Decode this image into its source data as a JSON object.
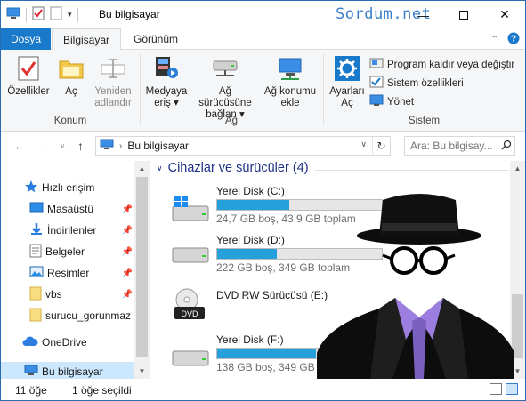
{
  "window": {
    "title": "Bu bilgisayar",
    "watermark": "Sordum.net"
  },
  "tabs": {
    "file": "Dosya",
    "computer": "Bilgisayar",
    "view": "Görünüm"
  },
  "ribbon": {
    "buttons": {
      "properties": "Özellikler",
      "open": "Aç",
      "rename_1": "Yeniden",
      "rename_2": "adlandır",
      "media_1": "Medyaya",
      "media_2": "eriş",
      "map_drive_1": "Ağ sürücüsüne",
      "map_drive_2": "bağlan",
      "add_network_1": "Ağ konumu",
      "add_network_2": "ekle",
      "settings_1": "Ayarları",
      "settings_2": "Aç",
      "uninstall": "Program kaldır veya değiştir",
      "system_properties": "Sistem özellikleri",
      "manage": "Yönet"
    },
    "groups": {
      "location": "Konum",
      "network": "Ağ",
      "system": "Sistem"
    }
  },
  "address": {
    "path": "Bu bilgisayar",
    "search_placeholder": "Ara: Bu bilgisay..."
  },
  "nav": {
    "quick_access": "Hızlı erişim",
    "items": [
      {
        "label": "Masaüstü",
        "pinned": true
      },
      {
        "label": "İndirilenler",
        "pinned": true
      },
      {
        "label": "Belgeler",
        "pinned": true
      },
      {
        "label": "Resimler",
        "pinned": true
      },
      {
        "label": "vbs",
        "pinned": true
      },
      {
        "label": "surucu_gorunmaz",
        "pinned": false
      }
    ],
    "onedrive": "OneDrive",
    "this_pc": "Bu bilgisayar"
  },
  "content": {
    "group_title": "Cihazlar ve sürücüler (4)",
    "drives": [
      {
        "name": "Yerel Disk (C:)",
        "info": "24,7 GB boş, 43,9 GB toplam",
        "used_fraction": 0.44
      },
      {
        "name": "Yerel Disk (D:)",
        "info": "222 GB boş, 349 GB toplam",
        "used_fraction": 0.36
      },
      {
        "name": "DVD RW Sürücüsü (E:)",
        "info": "",
        "used_fraction": null
      },
      {
        "name": "Yerel Disk (F:)",
        "info": "138 GB boş, 349 GB toplam",
        "used_fraction": 0.6
      }
    ]
  },
  "status": {
    "count": "11 öğe",
    "selected": "1 öğe seçildi"
  },
  "colors": {
    "accent": "#1979ca",
    "bar_fill": "#26a0da",
    "group_header": "#1e3287",
    "selection": "#cce8ff"
  }
}
